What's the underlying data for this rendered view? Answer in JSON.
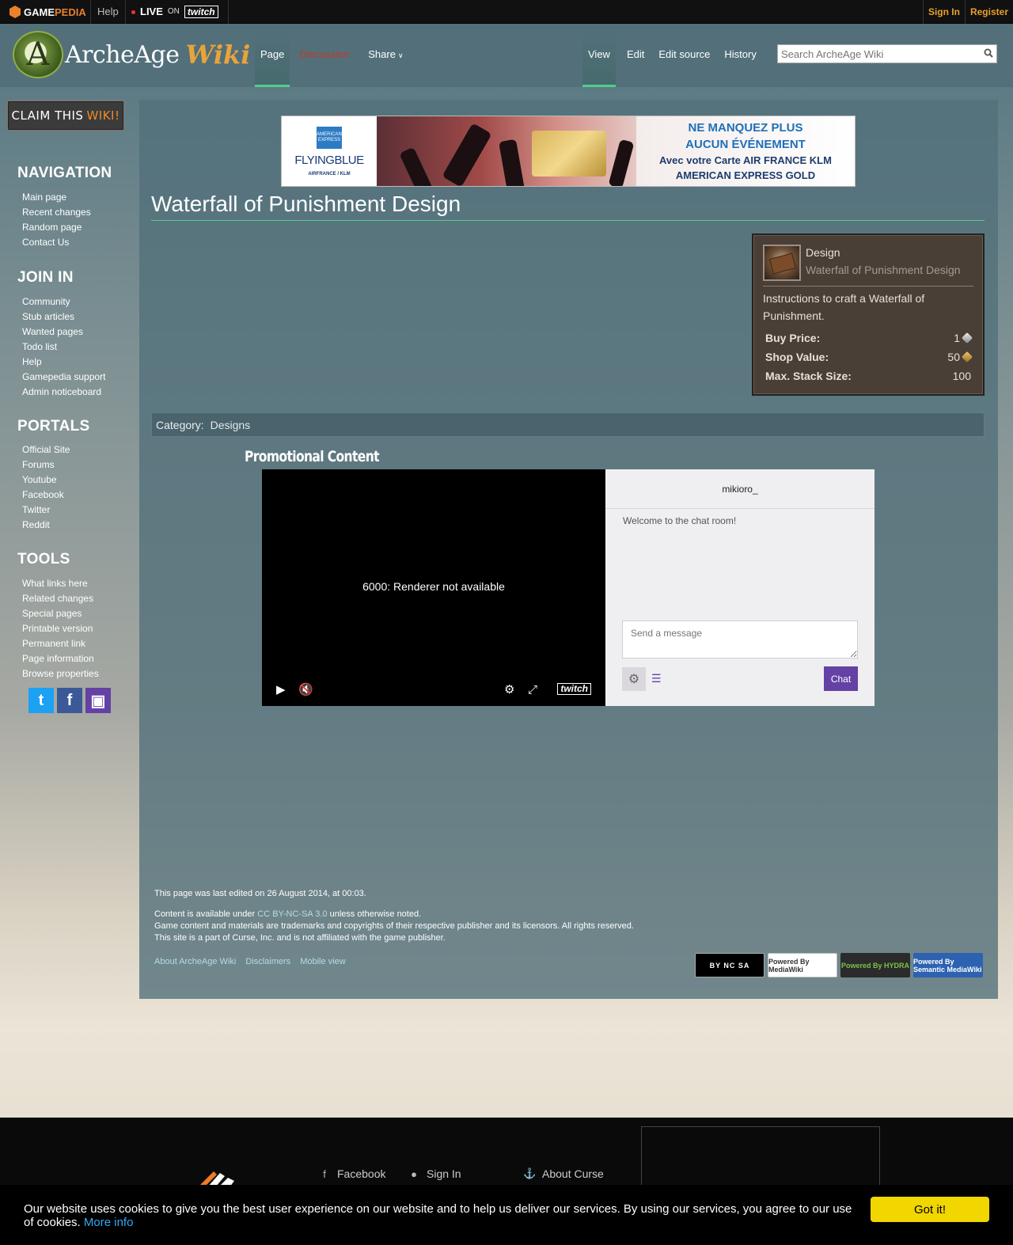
{
  "topbar": {
    "brand": "GAME",
    "brand_accent": "PEDIA",
    "help": "Help",
    "live": "LIVE",
    "on": "ON",
    "twitch": "twitch",
    "signin": "Sign In",
    "register": "Register"
  },
  "header": {
    "site_name": "ArcheAge",
    "site_wiki": "Wiki",
    "tabs_left": [
      "Page",
      "Discussion",
      "Share"
    ],
    "tabs_right": [
      "View",
      "Edit",
      "Edit source",
      "History"
    ],
    "search_placeholder": "Search ArcheAge Wiki"
  },
  "sidebar": {
    "claim": "CLAIM THIS",
    "claim_accent": "WIKI!",
    "sections": [
      {
        "title": "NAVIGATION",
        "items": [
          "Main page",
          "Recent changes",
          "Random page",
          "Contact Us"
        ]
      },
      {
        "title": "JOIN IN",
        "items": [
          "Community",
          "Stub articles",
          "Wanted pages",
          "Todo list",
          "Help",
          "Gamepedia support",
          "Admin noticeboard"
        ]
      },
      {
        "title": "PORTALS",
        "items": [
          "Official Site",
          "Forums",
          "Youtube",
          "Facebook",
          "Twitter",
          "Reddit"
        ]
      },
      {
        "title": "TOOLS",
        "items": [
          "What links here",
          "Related changes",
          "Special pages",
          "Printable version",
          "Permanent link",
          "Page information",
          "Browse properties"
        ]
      }
    ]
  },
  "ad": {
    "amex": "AMERICAN EXPRESS",
    "flyingblue": "FLYINGBLUE",
    "partners": "AIRFRANCE / KLM",
    "line1": "NE MANQUEZ PLUS",
    "line2": "AUCUN ÉVÉNEMENT",
    "line3": "Avec votre Carte AIR FRANCE KLM",
    "line4": "AMERICAN EXPRESS GOLD"
  },
  "page": {
    "title": "Waterfall of Punishment Design"
  },
  "infobox": {
    "type": "Design",
    "name": "Waterfall of Punishment Design",
    "description": "Instructions to craft a Waterfall of Punishment.",
    "rows": [
      {
        "label": "Buy Price:",
        "value": "1"
      },
      {
        "label": "Shop Value:",
        "value": "50"
      },
      {
        "label": "Max. Stack Size:",
        "value": "100"
      }
    ]
  },
  "category": {
    "label": "Category:",
    "value": "Designs"
  },
  "promo": {
    "heading": "Promotional Content",
    "error": "6000: Renderer not available",
    "channel": "mikioro_",
    "welcome": "Welcome to the chat room!",
    "message_placeholder": "Send a message",
    "chat_button": "Chat",
    "twitch": "twitch"
  },
  "footer": {
    "last_modified": "This page was last edited on 26 August 2014, at 00:03.",
    "license_prefix": "Content is available under",
    "license": "CC BY-NC-SA 3.0",
    "license_suffix": "unless otherwise noted.",
    "line2": "Game content and materials are trademarks and copyrights of their respective publisher and its licensors. All rights reserved.",
    "line3": "This site is a part of Curse, Inc. and is not affiliated with the game publisher.",
    "links": [
      "About ArcheAge Wiki",
      "Disclaimers",
      "Mobile view"
    ],
    "badges": [
      "BY NC SA",
      "Powered By MediaWiki",
      "Powered By HYDRA",
      "Powered By Semantic MediaWiki"
    ]
  },
  "curse_footer": {
    "links": [
      "Facebook",
      "Sign In",
      "About Curse"
    ]
  },
  "cookie": {
    "text": "Our website uses cookies to give you the best user experience on our website and to help us deliver our services. By using our services, you agree to our use of cookies.",
    "more": "More info",
    "button": "Got it!"
  }
}
